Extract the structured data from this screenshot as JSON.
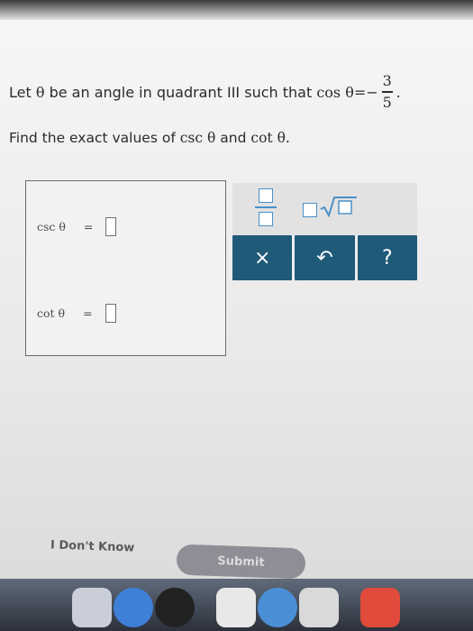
{
  "problem": {
    "line1_prefix": "Let",
    "theta": "θ",
    "line1_mid": "be an angle in quadrant III such that",
    "cos": "cos",
    "eq_neg": "=−",
    "fraction": {
      "numerator": "3",
      "denominator": "5"
    },
    "period": ".",
    "line2_prefix": "Find the exact values of",
    "csc": "csc",
    "and": "and",
    "cot": "cot"
  },
  "answers": [
    {
      "label": "csc θ",
      "equals": "="
    },
    {
      "label": "cot θ",
      "equals": "="
    }
  ],
  "toolbar": {
    "clear_symbol": "×",
    "undo_symbol": "↶",
    "help_symbol": "?"
  },
  "footer": {
    "dont_know": "I Don't Know",
    "submit": "Submit"
  },
  "colors": {
    "button_bg": "#1f5a78",
    "template_blue": "#4a90c8",
    "submit_bg": "#8e8e96"
  }
}
